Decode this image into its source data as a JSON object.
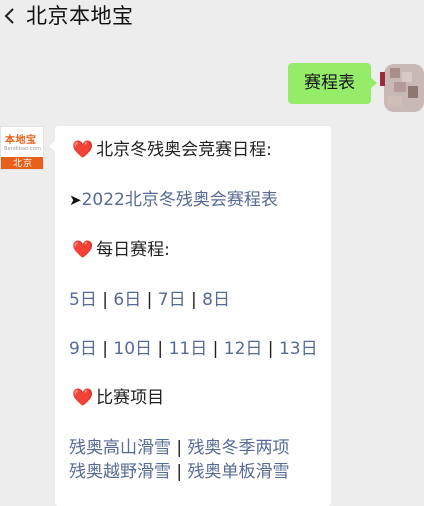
{
  "header": {
    "title": "北京本地宝"
  },
  "outgoing": {
    "text": "赛程表"
  },
  "bot": {
    "logo_name": "本地宝",
    "logo_sub": "Bendibao.com",
    "logo_city": "北京"
  },
  "message": {
    "heart": "❤️",
    "section1": "北京冬残奥会竞赛日程:",
    "arrow": "➤",
    "link1": "2022北京冬残奥会赛程表",
    "section2": "每日赛程:",
    "days_row1": [
      "5日",
      "6日",
      "7日",
      "8日"
    ],
    "days_row2": [
      "9日",
      "10日",
      "11日",
      "12日",
      "13日"
    ],
    "separator": "|",
    "section3": "比赛项目",
    "events_row1": [
      "残奥高山滑雪",
      "残奥冬季两项"
    ],
    "events_row2": [
      "残奥越野滑雪",
      "残奥单板滑雪"
    ]
  }
}
